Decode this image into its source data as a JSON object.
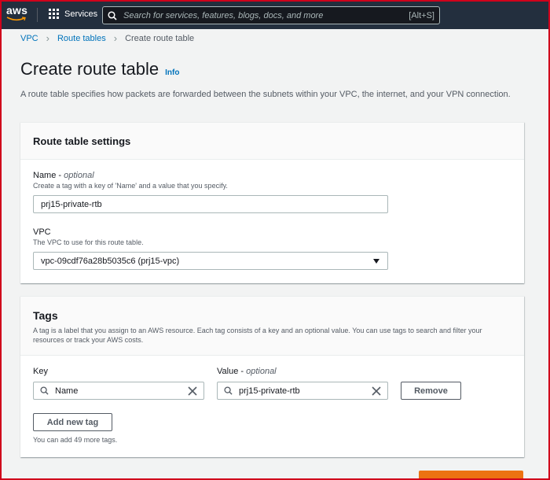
{
  "nav": {
    "logo_text": "aws",
    "services_label": "Services",
    "search_placeholder": "Search for services, features, blogs, docs, and more",
    "search_shortcut": "[Alt+S]"
  },
  "breadcrumb": [
    "VPC",
    "Route tables",
    "Create route table"
  ],
  "page": {
    "title": "Create route table",
    "info_link": "Info",
    "description": "A route table specifies how packets are forwarded between the subnets within your VPC, the internet, and your VPN connection."
  },
  "settings": {
    "heading": "Route table settings",
    "name_label": "Name - ",
    "name_optional": "optional",
    "name_desc": "Create a tag with a key of 'Name' and a value that you specify.",
    "name_value": "prj15-private-rtb",
    "vpc_label": "VPC",
    "vpc_desc": "The VPC to use for this route table.",
    "vpc_value": "vpc-09cdf76a28b5035c6 (prj15-vpc)"
  },
  "tags": {
    "heading": "Tags",
    "description": "A tag is a label that you assign to an AWS resource. Each tag consists of a key and an optional value. You can use tags to search and filter your resources or track your AWS costs.",
    "key_label": "Key",
    "value_label": "Value - ",
    "value_optional": "optional",
    "key_value": "Name",
    "value_value": "prj15-private-rtb",
    "remove_label": "Remove",
    "add_label": "Add new tag",
    "limit_note": "You can add 49 more tags."
  },
  "colors": {
    "nav_bg": "#232f3e",
    "link": "#0073bb",
    "primary_button": "#ec7211",
    "frame_border": "#d0021b"
  }
}
